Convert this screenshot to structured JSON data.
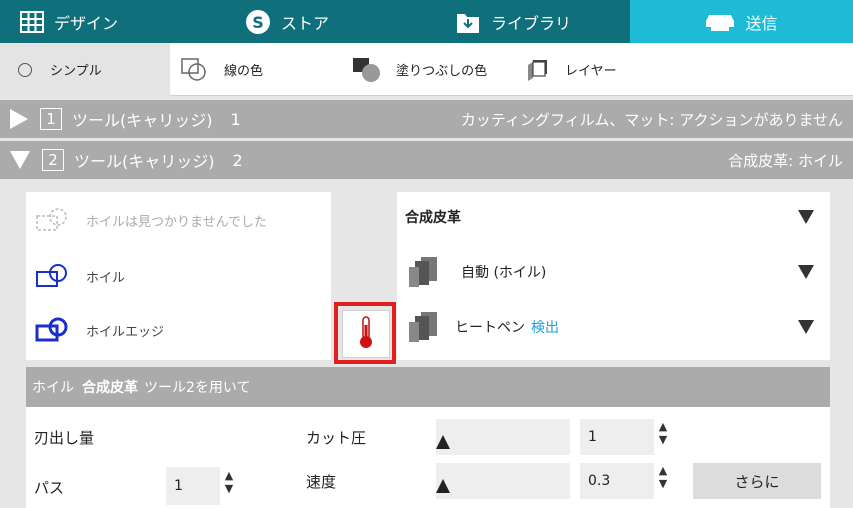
{
  "tabs": {
    "design": "デザイン",
    "store": "ストア",
    "library": "ライブラリ",
    "send": "送信"
  },
  "subtools": {
    "simple": "シンプル",
    "line_color": "線の色",
    "fill_color": "塗りつぶしの色",
    "layer": "レイヤー"
  },
  "tools": [
    {
      "number": "1",
      "label": "ツール(キャリッジ)",
      "index": "1",
      "status": "カッティングフィルム、マット: アクションがありません"
    },
    {
      "number": "2",
      "label": "ツール(キャリッジ)",
      "index": "2",
      "status": "合成皮革: ホイル"
    }
  ],
  "materials": {
    "not_found": "ホイルは見つかりませんでした",
    "foil": "ホイル",
    "foil_edge": "ホイルエッジ"
  },
  "dropdowns": {
    "material": "合成皮革",
    "action": "自動 (ホイル)",
    "tool_name": "ヒートペン",
    "tool_detect": "検出"
  },
  "settings": {
    "header_prefix": "ホイル",
    "header_material": "合成皮革",
    "header_suffix": "ツール2を用いて",
    "blade_depth_label": "刃出し量",
    "passes_label": "パス",
    "passes_value": "1",
    "force_label": "カット圧",
    "force_value": "1",
    "speed_label": "速度",
    "speed_value": "0.3",
    "more_button": "さらに",
    "spin_up": "▲",
    "spin_down": "▼"
  },
  "colors": {
    "tabbar": "#0f6f7b",
    "tab_active": "#1dbbd6",
    "highlight": "#e02020",
    "detect": "#1e9fd8",
    "icon_blue": "#1a2fc9"
  }
}
